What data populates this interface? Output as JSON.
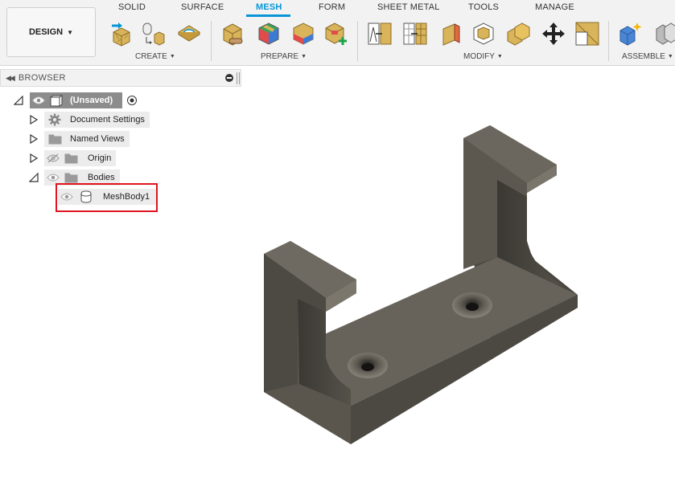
{
  "workspace": {
    "label": "DESIGN"
  },
  "tabs": [
    {
      "label": "SOLID"
    },
    {
      "label": "SURFACE"
    },
    {
      "label": "MESH",
      "active": true
    },
    {
      "label": "FORM"
    },
    {
      "label": "SHEET METAL"
    },
    {
      "label": "TOOLS"
    },
    {
      "label": "MANAGE"
    }
  ],
  "groups": {
    "create": "CREATE",
    "prepare": "PREPARE",
    "modify": "MODIFY",
    "assemble": "ASSEMBLE"
  },
  "browser": {
    "title": "BROWSER",
    "root": {
      "label": "(Unsaved)"
    },
    "items": [
      {
        "label": "Document Settings",
        "icon": "gear-icon"
      },
      {
        "label": "Named Views",
        "icon": "folder-icon"
      },
      {
        "label": "Origin",
        "icon": "folder-icon"
      },
      {
        "label": "Bodies",
        "icon": "folder-icon"
      }
    ],
    "body": {
      "label": "MeshBody1"
    }
  },
  "colors": {
    "accent": "#0696d7",
    "highlight": "#e0141e",
    "model": "#56524a"
  }
}
